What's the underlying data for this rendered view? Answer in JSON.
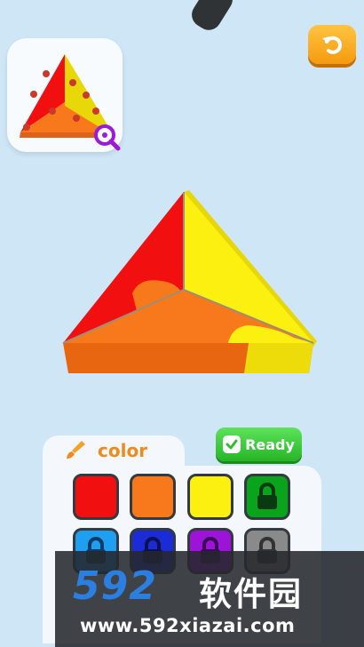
{
  "colors": {
    "background": "#cfe6f7",
    "red": "#f20f0f",
    "orange": "#f7791b",
    "yellow": "#fbf00f",
    "accent_orange": "#f08a1c",
    "ready_green": "#2fbe2f"
  },
  "toolbar": {
    "undo_icon": "undo-icon"
  },
  "reference": {
    "zoom_icon": "magnifier-icon"
  },
  "palette": {
    "title": "color",
    "brush_icon": "paintbrush-icon",
    "ready_label": "Ready",
    "swatches": [
      {
        "color": "#f20f0f",
        "locked": false
      },
      {
        "color": "#f7791b",
        "locked": false
      },
      {
        "color": "#fbf00f",
        "locked": false
      },
      {
        "color": "#0aa31c",
        "locked": true
      },
      {
        "color": "#1e9ff0",
        "locked": true
      },
      {
        "color": "#1b2bd6",
        "locked": true
      },
      {
        "color": "#9b14d8",
        "locked": true
      },
      {
        "color": "#8a8a8a",
        "locked": true
      }
    ]
  },
  "watermark": {
    "logo": "592",
    "name": "软件园",
    "url": "www.592xiazai.com"
  }
}
